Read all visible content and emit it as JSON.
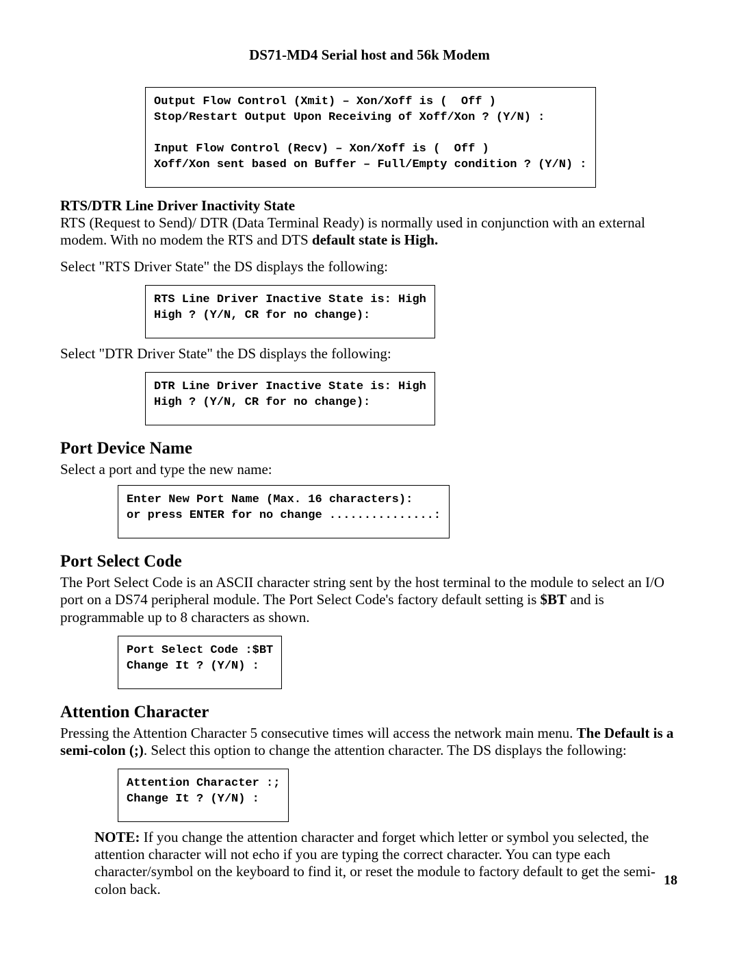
{
  "header": "DS71-MD4 Serial host and 56k Modem",
  "box1": "Output Flow Control (Xmit) – Xon/Xoff is (  Off )\nStop/Restart Output Upon Receiving of Xoff/Xon ? (Y/N) :\n\nInput Flow Control (Recv) – Xon/Xoff is (  Off )\nXoff/Xon sent based on Buffer – Full/Empty condition ? (Y/N) :",
  "sec_rts_h": "RTS/DTR Line Driver Inactivity State",
  "sec_rts_p1a": "RTS (Request to Send)/ DTR (Data Terminal Ready) is normally used in conjunction with an external modem. With no modem the RTS and DTS ",
  "sec_rts_p1b": "default state is High.",
  "sec_rts_p2": "Select \"RTS Driver State\" the DS displays the following:",
  "box2": "RTS Line Driver Inactive State is: High\nHigh ? (Y/N, CR for no change):",
  "sec_rts_p3": "Select \"DTR Driver State\" the DS displays the following:",
  "box3": "DTR Line Driver Inactive State is: High\nHigh ? (Y/N, CR for no change):",
  "sec_pdn_h": "Port Device Name",
  "sec_pdn_p": "Select a port and type the new name:",
  "box4": "Enter New Port Name (Max. 16 characters):\nor press ENTER for no change ...............:",
  "sec_psc_h": "Port Select Code",
  "sec_psc_p1": "The Port Select Code is an ASCII character string sent by the host terminal to the module to select an I/O port on a DS74 peripheral module. The Port Select Code's factory default setting is ",
  "sec_psc_p1b": "$BT",
  "sec_psc_p1c": " and is programmable up to 8 characters as shown.",
  "box5": "Port Select Code :$BT\nChange It ? (Y/N) :",
  "sec_ac_h": "Attention Character",
  "sec_ac_p1a": "Pressing the Attention Character 5 consecutive times will access the network main menu. ",
  "sec_ac_p1b": "The Default is a semi-colon (;)",
  "sec_ac_p1c": ". Select this option to change the attention character. The DS displays the following:",
  "box6": "Attention Character :;\nChange It ? (Y/N) :",
  "note_b": "NOTE:",
  "note_t": " If you change the attention character and forget which letter or symbol you selected, the attention character will not echo if you are typing the correct character. You can type each character/symbol on the keyboard to find it, or reset the module to factory default to get the semi-colon back.",
  "pagenum": "18"
}
